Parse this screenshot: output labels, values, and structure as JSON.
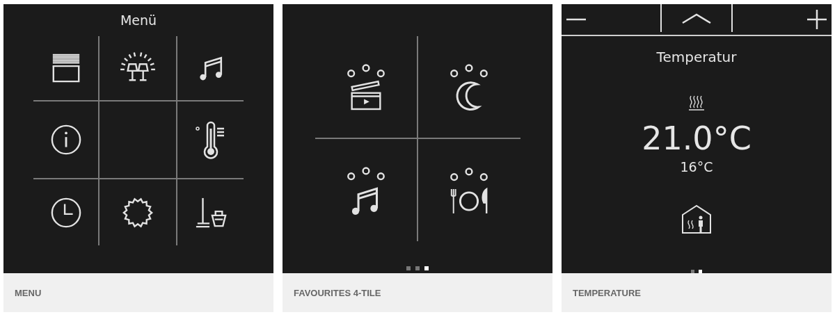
{
  "panels": [
    {
      "kind": "menu",
      "title": "Menü",
      "caption": "MENU"
    },
    {
      "kind": "favourites",
      "caption": "FAVOURITES 4-TILE",
      "pager": [
        {
          "selected": false
        },
        {
          "selected": false
        },
        {
          "selected": true
        }
      ]
    },
    {
      "kind": "temperature",
      "title": "Temperatur",
      "value": "21.0°C",
      "setpoint": "16°C",
      "caption": "TEMPERATURE",
      "pager": [
        {
          "selected": false
        },
        {
          "selected": true
        }
      ]
    }
  ]
}
